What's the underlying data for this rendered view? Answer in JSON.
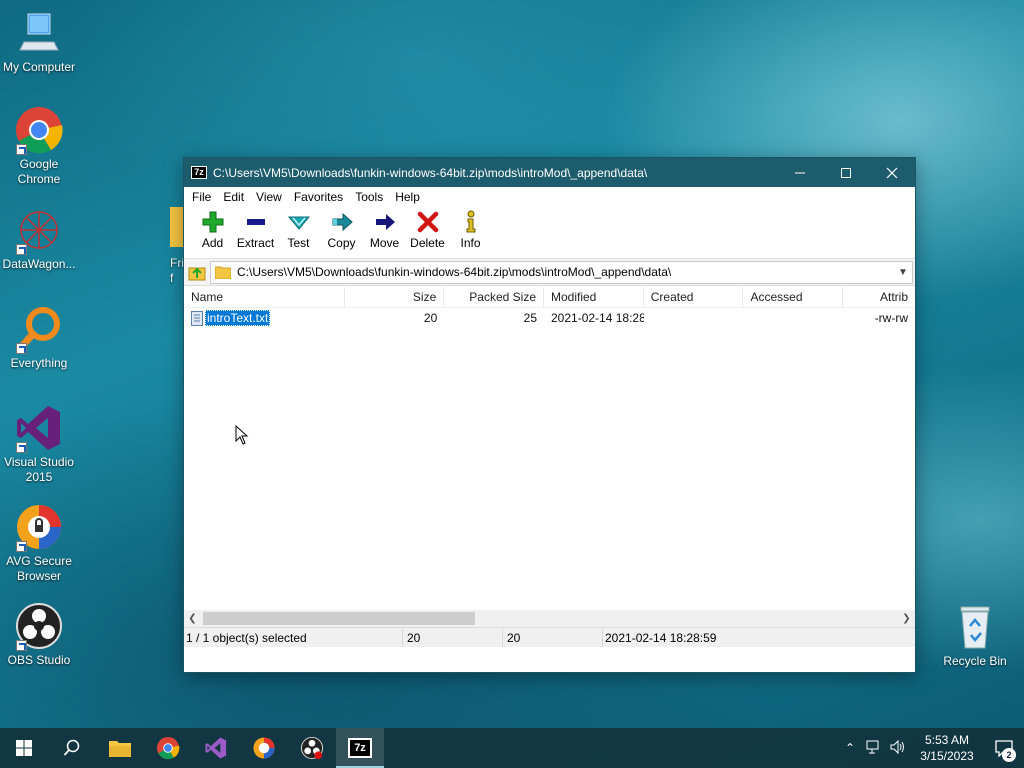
{
  "desktop": {
    "icons": [
      {
        "label": "My Computer"
      },
      {
        "label": "Google Chrome"
      },
      {
        "label": "DataWagon..."
      },
      {
        "label": "Everything"
      },
      {
        "label": "Visual Studio 2015"
      },
      {
        "label": "AVG Secure Browser"
      },
      {
        "label": "OBS Studio"
      },
      {
        "label": "Recycle Bin"
      }
    ],
    "partial_label": "Frid f"
  },
  "window": {
    "app_badge": "7z",
    "title": "C:\\Users\\VM5\\Downloads\\funkin-windows-64bit.zip\\mods\\introMod\\_append\\data\\",
    "menu": [
      "File",
      "Edit",
      "View",
      "Favorites",
      "Tools",
      "Help"
    ],
    "toolbar": [
      {
        "label": "Add",
        "icon": "add-icon",
        "color": "#1fa82b"
      },
      {
        "label": "Extract",
        "icon": "extract-icon",
        "color": "#1a1a8a"
      },
      {
        "label": "Test",
        "icon": "test-icon",
        "color": "#1aa7b4"
      },
      {
        "label": "Copy",
        "icon": "copy-icon",
        "color": "#1a8a9a"
      },
      {
        "label": "Move",
        "icon": "move-icon",
        "color": "#15157a"
      },
      {
        "label": "Delete",
        "icon": "delete-icon",
        "color": "#d01515"
      },
      {
        "label": "Info",
        "icon": "info-icon",
        "color": "#e0c020"
      }
    ],
    "address": "C:\\Users\\VM5\\Downloads\\funkin-windows-64bit.zip\\mods\\introMod\\_append\\data\\",
    "columns": [
      "Name",
      "Size",
      "Packed Size",
      "Modified",
      "Created",
      "Accessed",
      "Attrib"
    ],
    "files": [
      {
        "name": "introText.txt",
        "size": "20",
        "packed": "25",
        "modified": "2021-02-14 18:28",
        "created": "",
        "accessed": "",
        "attrib": "-rw-rw"
      }
    ],
    "status": {
      "selected": "1 / 1 object(s) selected",
      "size": "20",
      "packed": "20",
      "modified": "2021-02-14 18:28:59"
    }
  },
  "taskbar": {
    "time": "5:53 AM",
    "date": "3/15/2023",
    "notifications": "2",
    "active_app_label": "7z"
  }
}
